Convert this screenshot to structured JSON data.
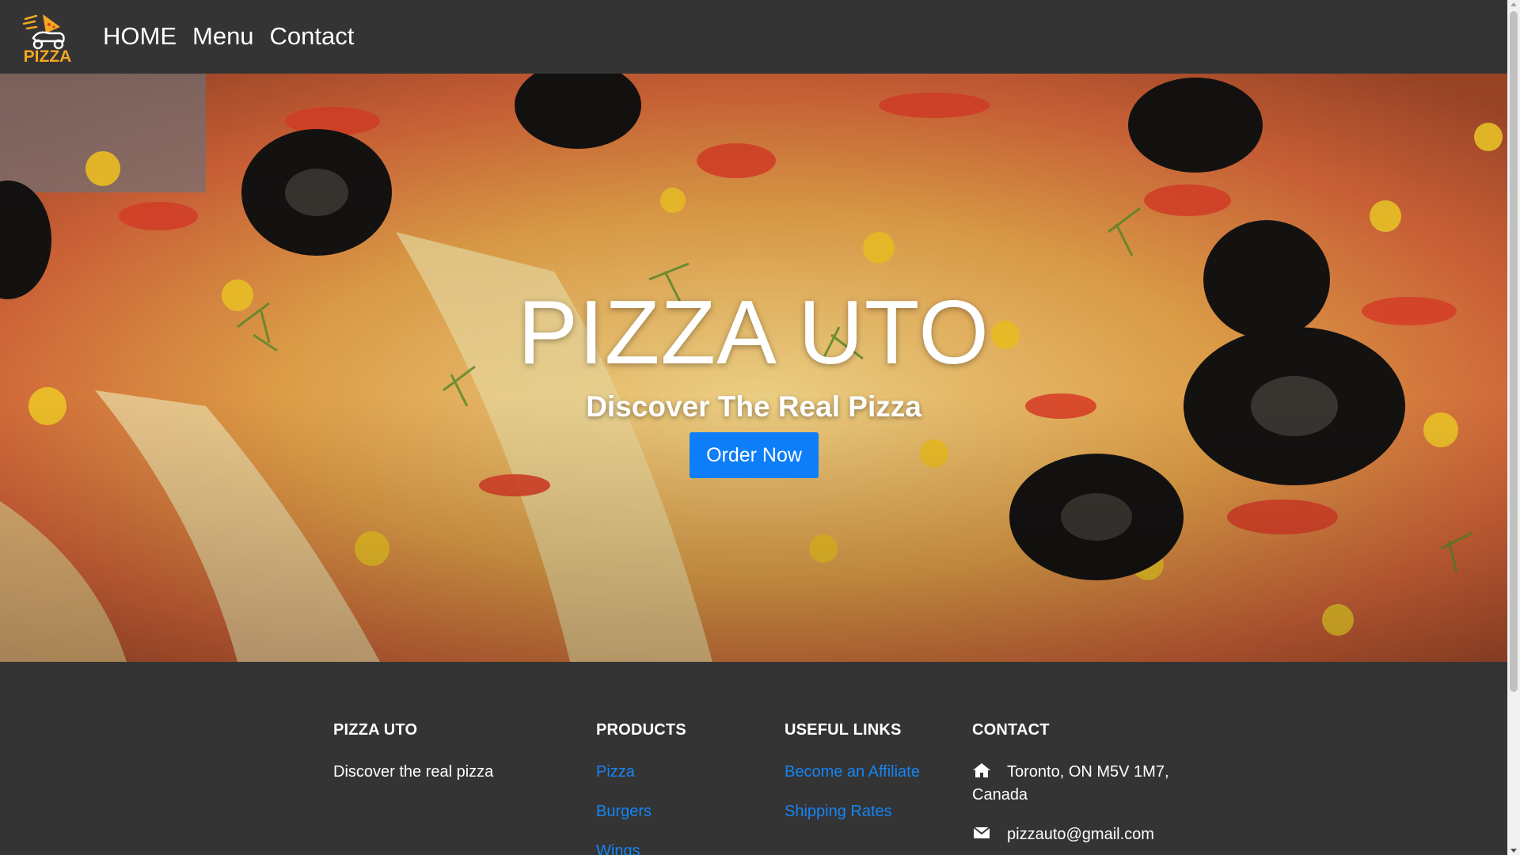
{
  "brand": {
    "logo_text": "PIZZA"
  },
  "nav": {
    "items": [
      {
        "label": "HOME"
      },
      {
        "label": "Menu"
      },
      {
        "label": "Contact"
      }
    ]
  },
  "hero": {
    "title": "PIZZA UTO",
    "subtitle": "Discover The Real Pizza",
    "cta_label": "Order Now"
  },
  "footer": {
    "about": {
      "heading": "PIZZA UTO",
      "text": "Discover the real pizza"
    },
    "products": {
      "heading": "PRODUCTS",
      "links": [
        {
          "label": "Pizza"
        },
        {
          "label": "Burgers"
        },
        {
          "label": "Wings"
        }
      ]
    },
    "useful_links": {
      "heading": "USEFUL LINKS",
      "links": [
        {
          "label": "Become an Affiliate"
        },
        {
          "label": "Shipping Rates"
        }
      ]
    },
    "contact": {
      "heading": "CONTACT",
      "address": "Toronto, ON M5V 1M7, Canada",
      "email": "pizzauto@gmail.com"
    }
  },
  "icons": {
    "home": "home-icon",
    "email": "envelope-icon",
    "logo": "pizza-scooter-logo"
  },
  "colors": {
    "nav_bg": "#343434",
    "accent": "#0d7ef7",
    "link": "#1585f5",
    "logo_orange": "#f5a623"
  }
}
